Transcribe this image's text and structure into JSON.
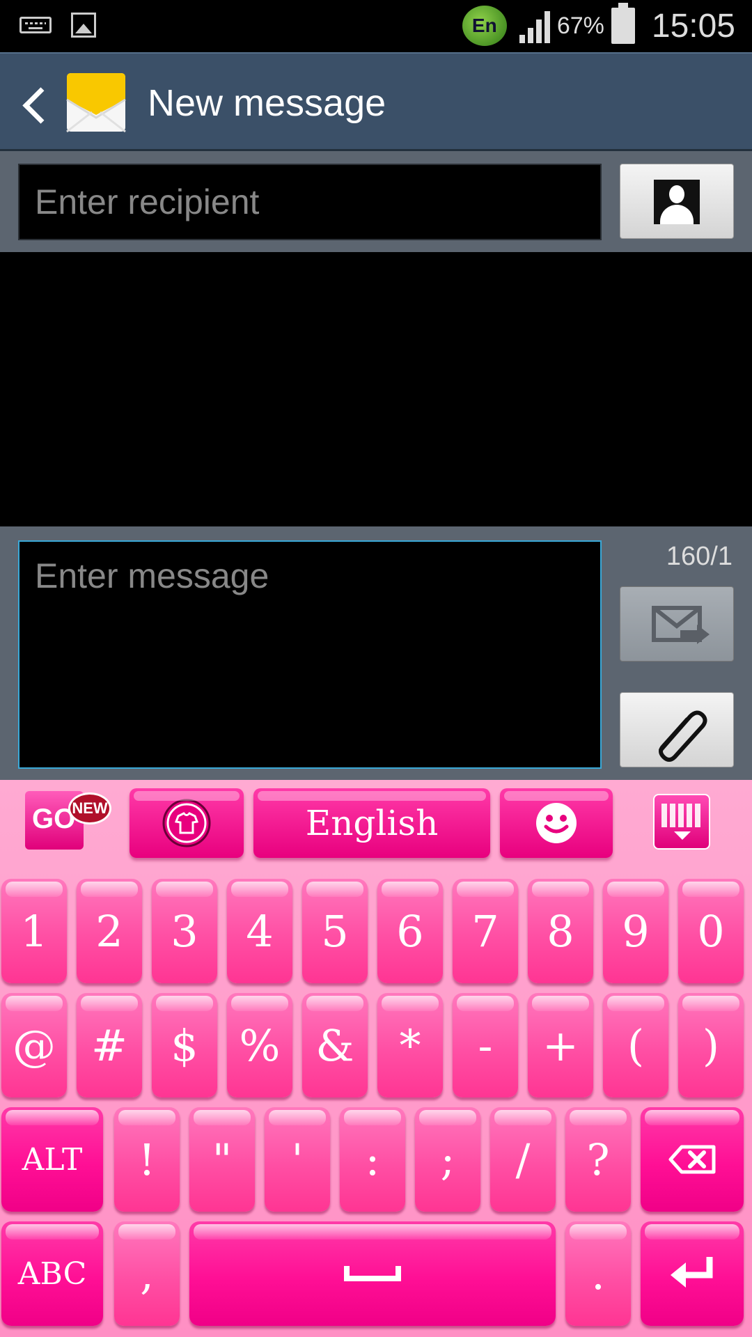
{
  "status_bar": {
    "language_badge": "En",
    "battery_percent": "67%",
    "time": "15:05",
    "icons": [
      "keyboard-icon",
      "image-icon",
      "language-badge",
      "signal-icon",
      "battery-icon"
    ]
  },
  "action_bar": {
    "title": "New message",
    "icons": [
      "back-icon",
      "messaging-app-icon"
    ]
  },
  "recipient": {
    "placeholder": "Enter recipient"
  },
  "compose": {
    "placeholder": "Enter message",
    "char_counter": "160/1"
  },
  "keyboard": {
    "colors": {
      "primary": "#ff0f95",
      "light": "#ff78bd",
      "background": "#ffaad2"
    },
    "toolbar": {
      "go_label": "GO",
      "new_badge": "NEW",
      "language_label": "English"
    },
    "row1": [
      "1",
      "2",
      "3",
      "4",
      "5",
      "6",
      "7",
      "8",
      "9",
      "0"
    ],
    "row2": [
      "@",
      "#",
      "$",
      "%",
      "&",
      "*",
      "-",
      "+",
      "(",
      ")"
    ],
    "row3": [
      "ALT",
      "!",
      "\"",
      "'",
      ":",
      ";",
      "/",
      "?"
    ],
    "row4": [
      "ABC",
      ",",
      ".",
      ""
    ]
  }
}
